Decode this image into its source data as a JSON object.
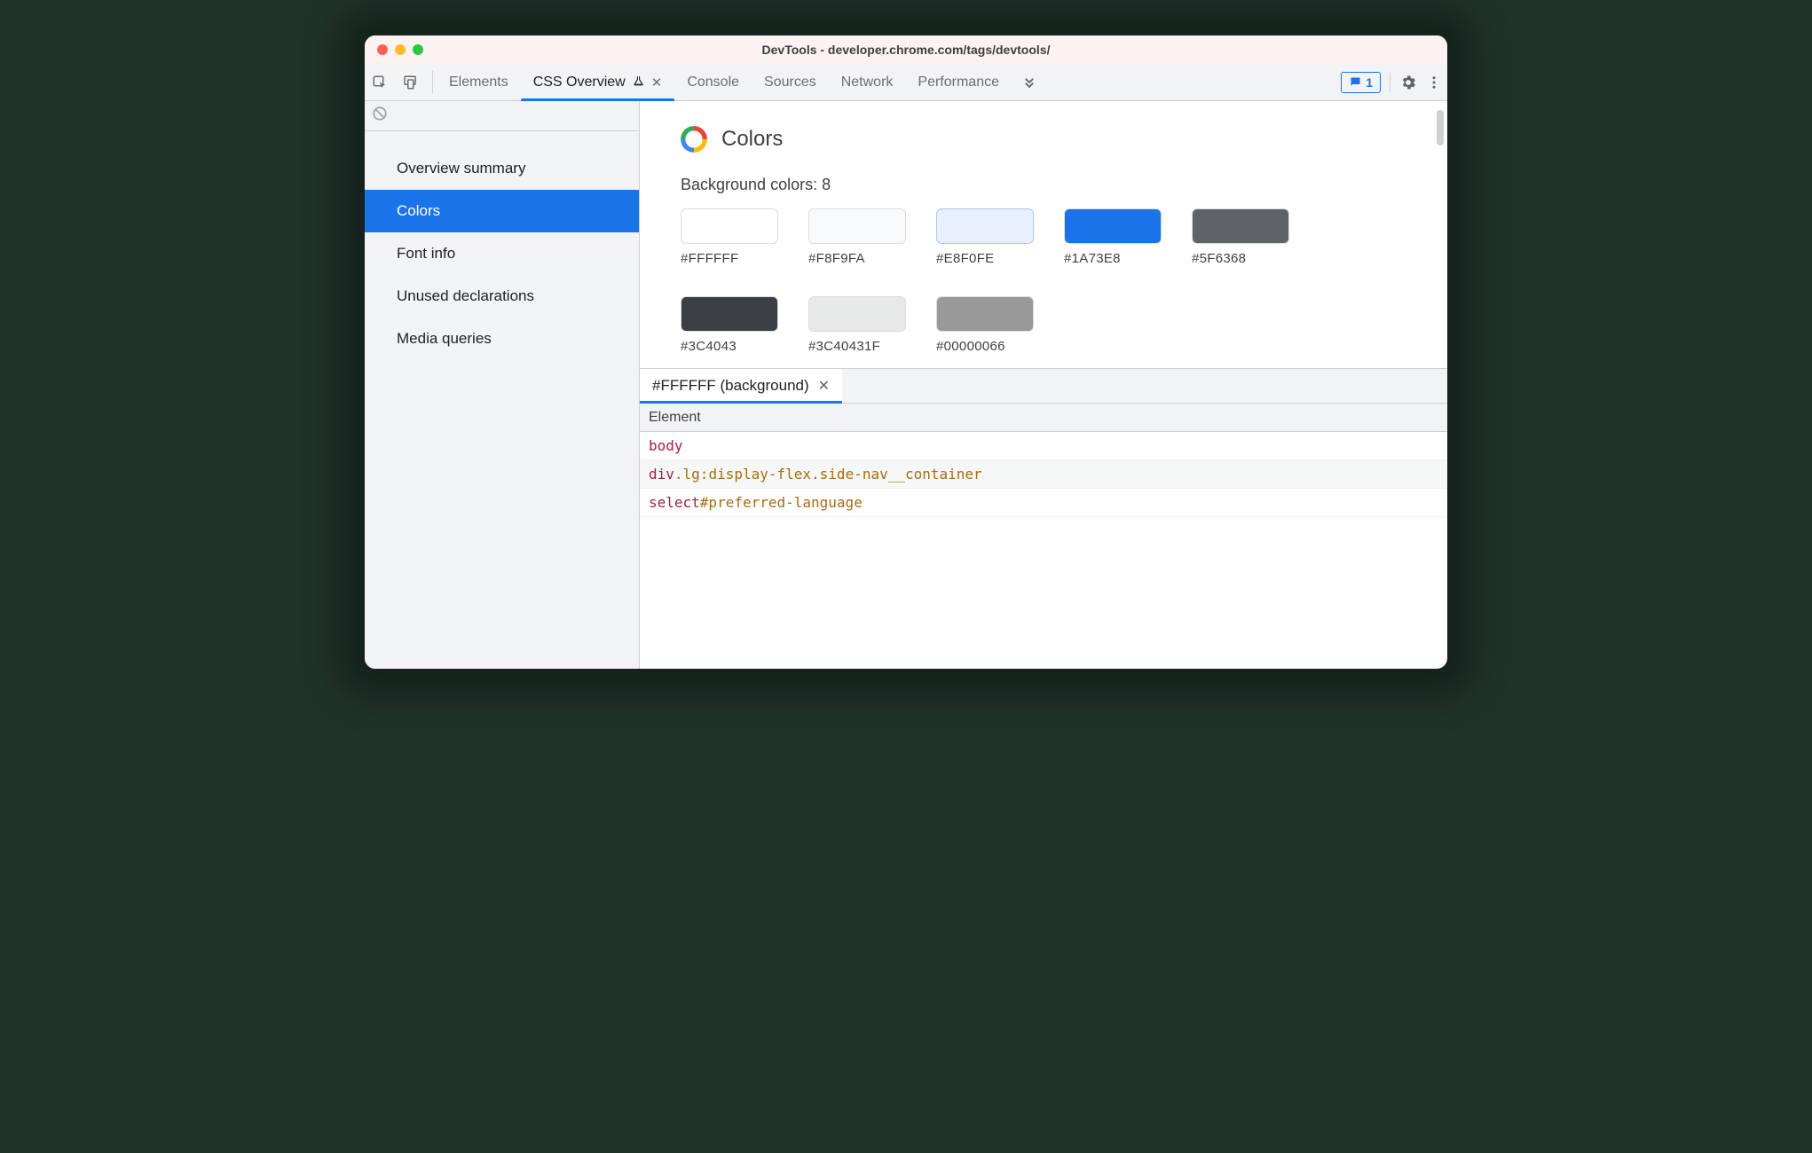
{
  "window": {
    "title": "DevTools - developer.chrome.com/tags/devtools/"
  },
  "tabs": {
    "items": [
      {
        "label": "Elements"
      },
      {
        "label": "CSS Overview"
      },
      {
        "label": "Console"
      },
      {
        "label": "Sources"
      },
      {
        "label": "Network"
      },
      {
        "label": "Performance"
      }
    ],
    "active_index": 1,
    "active_experiment": true,
    "message_count": "1"
  },
  "sidebar": {
    "items": [
      {
        "label": "Overview summary"
      },
      {
        "label": "Colors"
      },
      {
        "label": "Font info"
      },
      {
        "label": "Unused declarations"
      },
      {
        "label": "Media queries"
      }
    ],
    "active_index": 1
  },
  "section": {
    "title": "Colors",
    "subtitle": "Background colors: 8",
    "swatches": [
      {
        "label": "#FFFFFF",
        "color": "#FFFFFF"
      },
      {
        "label": "#F8F9FA",
        "color": "#F8F9FA"
      },
      {
        "label": "#E8F0FE",
        "color": "#E8F0FE"
      },
      {
        "label": "#1A73E8",
        "color": "#1A73E8"
      },
      {
        "label": "#5F6368",
        "color": "#5F6368"
      },
      {
        "label": "#3C4043",
        "color": "#3C4043"
      },
      {
        "label": "#3C40431F",
        "color": "#3C40431F"
      },
      {
        "label": "#00000066",
        "color": "#00000066"
      }
    ]
  },
  "detail": {
    "tab_label": "#FFFFFF (background)",
    "column_header": "Element",
    "rows": [
      {
        "tag": "body",
        "cls": "",
        "id": ""
      },
      {
        "tag": "div",
        "cls": ".lg:display-flex.side-nav__container",
        "id": ""
      },
      {
        "tag": "select",
        "cls": "",
        "id": "#preferred-language"
      }
    ]
  }
}
